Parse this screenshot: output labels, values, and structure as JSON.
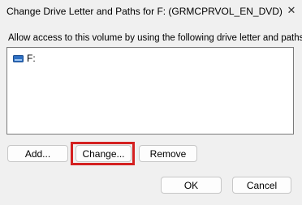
{
  "window": {
    "title": "Change Drive Letter and Paths for F: (GRMCPRVOL_EN_DVD)",
    "close_icon": "close-icon",
    "close_symbol": "✕"
  },
  "instruction": "Allow access to this volume by using the following drive letter and paths:",
  "paths": [
    {
      "icon": "drive-icon",
      "label": "F:"
    }
  ],
  "buttons": {
    "add": "Add...",
    "change": "Change...",
    "remove": "Remove",
    "ok": "OK",
    "cancel": "Cancel"
  },
  "colors": {
    "highlight": "#d42020",
    "drive_icon": "#2e6fc2"
  }
}
